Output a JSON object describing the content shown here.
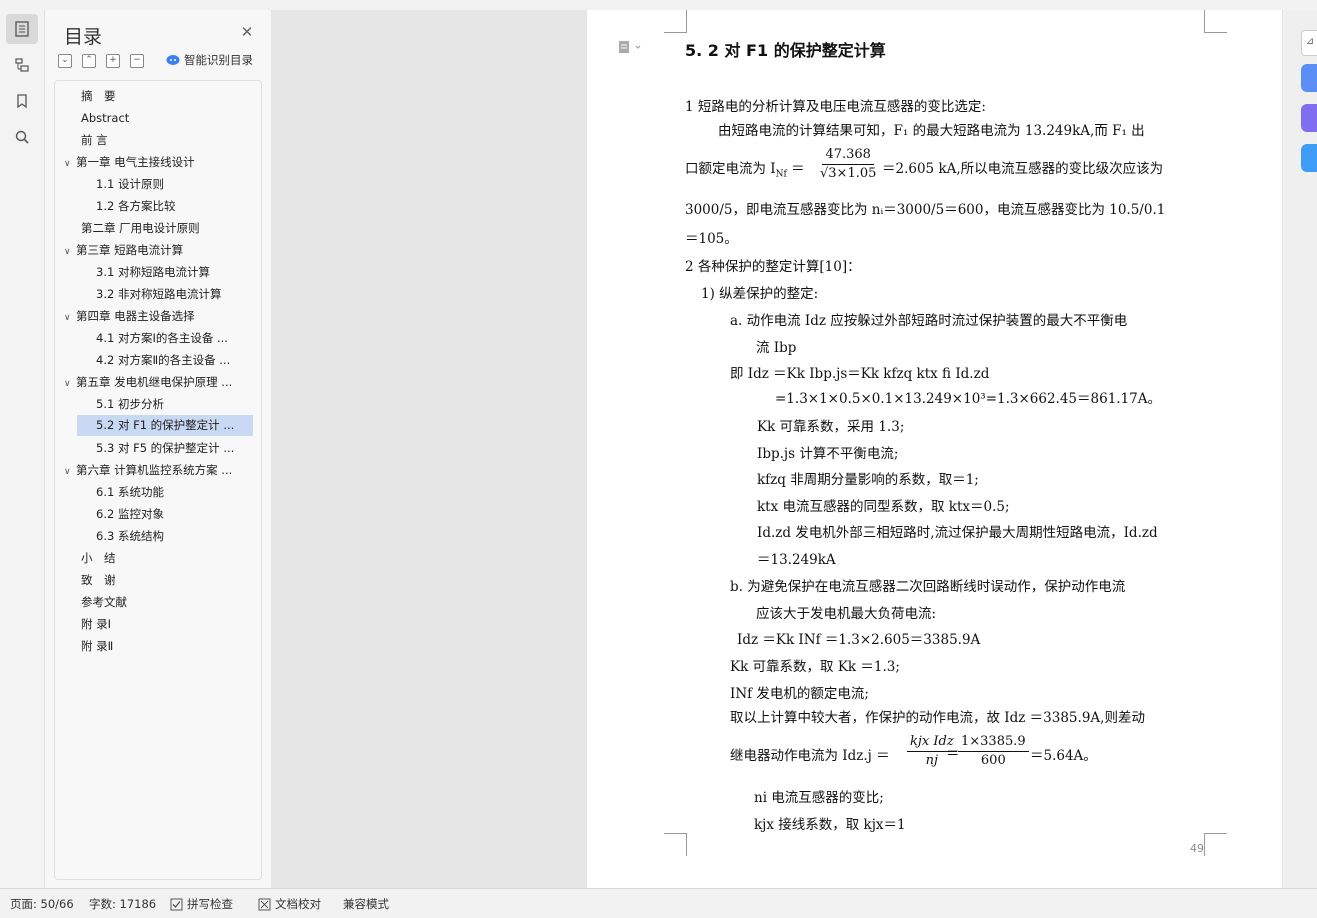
{
  "status": {
    "page": "页面: 50/66",
    "words": "字数: 17186",
    "spell": "拼写检查",
    "proof": "文档校对",
    "compat": "兼容模式"
  },
  "toc": {
    "title": "目录",
    "smart": "智能识别目录",
    "items": [
      {
        "label": "摘　要"
      },
      {
        "label": "Abstract"
      },
      {
        "label": "前 言"
      },
      {
        "label": "第一章  电气主接线设计"
      },
      {
        "label": "1.1  设计原则"
      },
      {
        "label": "1.2  各方案比较"
      },
      {
        "label": "第二章  厂用电设计原则"
      },
      {
        "label": "第三章  短路电流计算"
      },
      {
        "label": "3.1  对称短路电流计算"
      },
      {
        "label": "3.2  非对称短路电流计算"
      },
      {
        "label": "第四章  电器主设备选择"
      },
      {
        "label": "4.1 对方案Ⅰ的各主设备 ..."
      },
      {
        "label": "4.2  对方案Ⅱ的各主设备 ..."
      },
      {
        "label": "第五章  发电机继电保护原理 ..."
      },
      {
        "label": "5.1  初步分析"
      },
      {
        "label": "5.2  对 F1  的保护整定计 ..."
      },
      {
        "label": "5.3  对 F5 的保护整定计 ..."
      },
      {
        "label": "第六章  计算机监控系统方案 ..."
      },
      {
        "label": "6.1  系统功能"
      },
      {
        "label": "6.2  监控对象"
      },
      {
        "label": "6.3  系统结构"
      },
      {
        "label": "小　结"
      },
      {
        "label": "致　谢"
      },
      {
        "label": "参考文献"
      },
      {
        "label": "附 录Ⅰ"
      },
      {
        "label": "附 录Ⅱ"
      }
    ]
  },
  "doc": {
    "heading": "5. 2  对 F1  的保护整定计算",
    "lines": [
      "1  短路电的分析计算及电压电流互感器的变比选定:",
      "由短路电流的计算结果可知，F₁ 的最大短路电流为 13.249kA,而  F₁ 出",
      "口额定电流为 I",
      "47.368",
      "√3×1.05",
      "＝2.605 kA,所以电流互感器的变比级次应该为",
      "3000/5，即电流互感器变比为 nᵢ＝3000/5＝600，电流互感器变比为  10.5/0.1",
      "＝105。",
      "2  各种保护的整定计算[10]：",
      "1)  纵差保护的整定:",
      "a.   动作电流 Idz  应按躲过外部短路时流过保护装置的最大不平衡电",
      "流 Ibp",
      "即 Idz  ＝Kk Ibp.js＝Kk kfzq ktx fi Id.zd",
      "=1.3×1×0.5×0.1×13.249×10³=1.3×662.45＝861.17A。",
      "Kk   可靠系数，采用 1.3;",
      "Ibp.js  计算不平衡电流;",
      "kfzq  非周期分量影响的系数，取＝1;",
      "ktx  电流互感器的同型系数，取 ktx＝0.5;",
      "Id.zd  发电机外部三相短路时,流过保护最大周期性短路电流，Id.zd",
      "＝13.249kA",
      "b.   为避免保护在电流互感器二次回路断线时误动作，保护动作电流",
      "应该大于发电机最大负荷电流:",
      "Idz  ＝Kk INf  ＝1.3×2.605＝3385.9A",
      "Kk  可靠系数，取  Kk  ＝1.3;",
      "INf  发电机的额定电流;",
      "取以上计算中较大者，作保护的动作电流，故 Idz  ＝3385.9A,则差动",
      "继电器动作电流为 Idz.j  ＝",
      "kjx Idz",
      "nj",
      "1×3385.9",
      "600",
      "＝5.64A。",
      "ni   电流互感器的变比;",
      "kjx 接线系数，取 kjx＝1"
    ],
    "page_number": "49"
  }
}
